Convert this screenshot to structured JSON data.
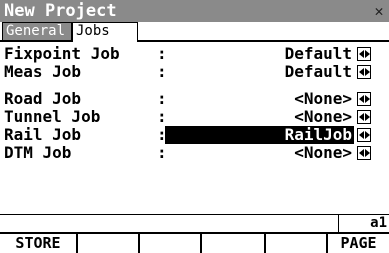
{
  "window": {
    "title": "New Project",
    "close_glyph": "✕"
  },
  "tabs": [
    {
      "label": "General",
      "active": false
    },
    {
      "label": "Jobs",
      "active": true
    }
  ],
  "fields": [
    {
      "label": "Fixpoint Job",
      "colon": ":",
      "value": "Default"
    },
    {
      "label": "Meas Job",
      "colon": ":",
      "value": "Default"
    },
    {
      "label": "Road Job",
      "colon": ":",
      "value": "<None>"
    },
    {
      "label": "Tunnel Job",
      "colon": ":",
      "value": "<None>"
    },
    {
      "label": "Rail Job",
      "colon": ":",
      "value": "RailJob",
      "selected": true
    },
    {
      "label": "DTM Job",
      "colon": ":",
      "value": "<None>"
    }
  ],
  "status": {
    "indicator": "a1"
  },
  "softkeys": [
    {
      "label": "STORE"
    },
    {
      "label": ""
    },
    {
      "label": ""
    },
    {
      "label": ""
    },
    {
      "label": ""
    },
    {
      "label": "PAGE"
    }
  ],
  "colors": {
    "title_bar": "#8a8a8a",
    "selection": "#000000"
  },
  "icons": {
    "selector": "left-right-arrows-icon",
    "close": "close-icon"
  }
}
